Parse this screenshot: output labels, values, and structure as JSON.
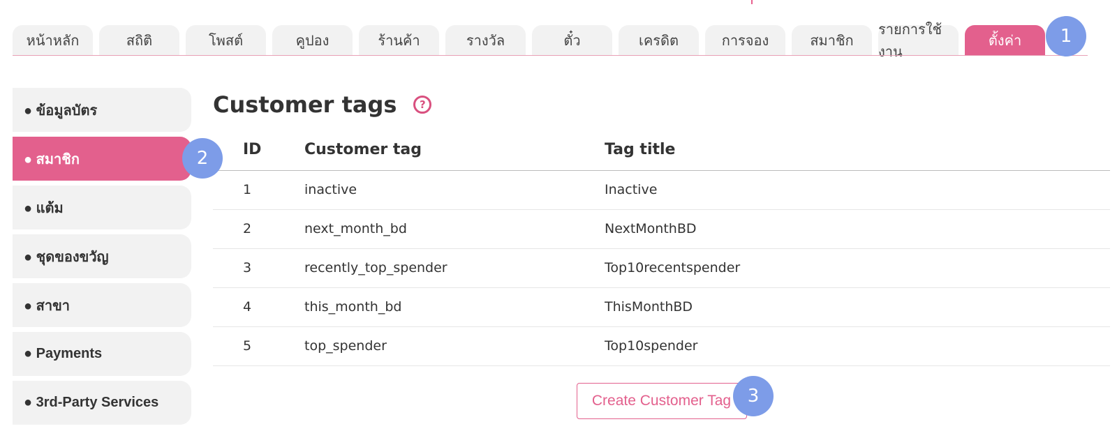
{
  "top_tabs": [
    {
      "label": "หน้าหลัก",
      "active": false
    },
    {
      "label": "สถิติ",
      "active": false
    },
    {
      "label": "โพสต์",
      "active": false
    },
    {
      "label": "คูปอง",
      "active": false
    },
    {
      "label": "ร้านค้า",
      "active": false
    },
    {
      "label": "รางวัล",
      "active": false
    },
    {
      "label": "ตั๋ว",
      "active": false
    },
    {
      "label": "เครดิต",
      "active": false
    },
    {
      "label": "การจอง",
      "active": false
    },
    {
      "label": "สมาชิก",
      "active": false
    },
    {
      "label": "รายการใช้งาน",
      "active": false
    },
    {
      "label": "ตั้งค่า",
      "active": true
    }
  ],
  "sidebar": {
    "items": [
      {
        "label": "● ข้อมูลบัตร",
        "active": false
      },
      {
        "label": "● สมาชิก",
        "active": true
      },
      {
        "label": "● แต้ม",
        "active": false
      },
      {
        "label": "● ชุดของขวัญ",
        "active": false
      },
      {
        "label": "● สาขา",
        "active": false
      },
      {
        "label": "● Payments",
        "active": false
      },
      {
        "label": "● 3rd-Party Services",
        "active": false
      }
    ]
  },
  "main": {
    "title": "Customer tags",
    "help_icon": "question-circle-icon",
    "help_glyph": "?",
    "table": {
      "headers": {
        "id": "ID",
        "tag": "Customer tag",
        "title": "Tag title"
      },
      "rows": [
        {
          "id": "1",
          "tag": "inactive",
          "title": "Inactive"
        },
        {
          "id": "2",
          "tag": "next_month_bd",
          "title": "NextMonthBD"
        },
        {
          "id": "3",
          "tag": "recently_top_spender",
          "title": "Top10recentspender"
        },
        {
          "id": "4",
          "tag": "this_month_bd",
          "title": "ThisMonthBD"
        },
        {
          "id": "5",
          "tag": "top_spender",
          "title": "Top10spender"
        }
      ]
    },
    "create_button": "Create Customer Tag"
  },
  "step_badges": [
    "1",
    "2",
    "3"
  ],
  "colors": {
    "accent": "#e3608d",
    "badge": "#7d9ce8",
    "tab_bg": "#f2f2f2"
  }
}
